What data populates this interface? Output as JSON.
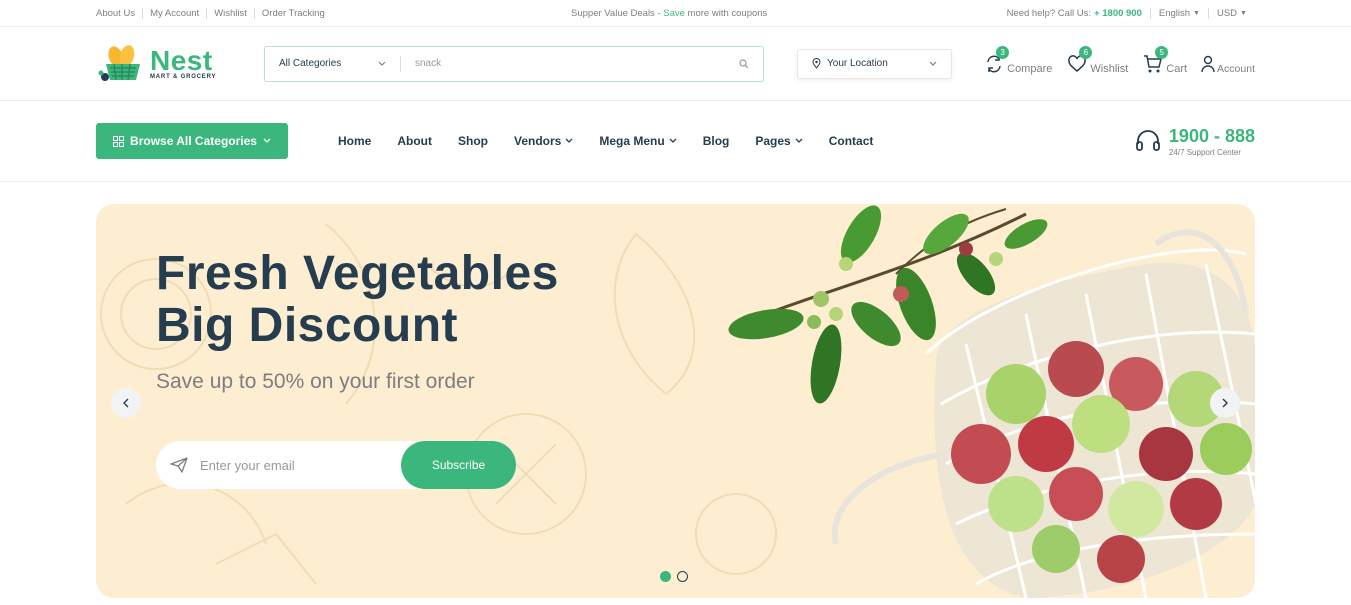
{
  "topbar": {
    "links": [
      "About Us",
      "My Account",
      "Wishlist",
      "Order Tracking"
    ],
    "promo_prefix": "Supper Value Deals - ",
    "promo_highlight": "Save",
    "promo_suffix": " more with coupons",
    "help_label": "Need help? Call Us: ",
    "help_phone": "+ 1800 900",
    "language": "English",
    "currency": "USD"
  },
  "header": {
    "logo_name": "Nest",
    "logo_tagline": "MART & GROCERY",
    "category_select": "All Categories",
    "search_value": "snack",
    "location": "Your Location",
    "actions": [
      {
        "label": "Compare",
        "count": "3",
        "icon": "compare-icon"
      },
      {
        "label": "Wishlist",
        "count": "6",
        "icon": "heart-icon"
      },
      {
        "label": "Cart",
        "count": "5",
        "icon": "cart-icon"
      },
      {
        "label": "Account",
        "icon": "user-icon"
      }
    ]
  },
  "nav": {
    "browse_label": "Browse All Categories",
    "items": [
      "Home",
      "About",
      "Shop",
      "Vendors",
      "Mega Menu",
      "Blog",
      "Pages",
      "Contact"
    ],
    "support_number": "1900 - 888",
    "support_label": "24/7 Support Center"
  },
  "hero": {
    "title_line1": "Fresh Vegetables",
    "title_line2": "Big Discount",
    "subtitle": "Save up to 50% on your first order",
    "email_placeholder": "Enter your email",
    "subscribe_label": "Subscribe",
    "slide_count": 2,
    "active_slide": 1
  },
  "colors": {
    "brand_green": "#3bb77e",
    "heading": "#253d4e",
    "hero_bg": "#fdeed2"
  }
}
